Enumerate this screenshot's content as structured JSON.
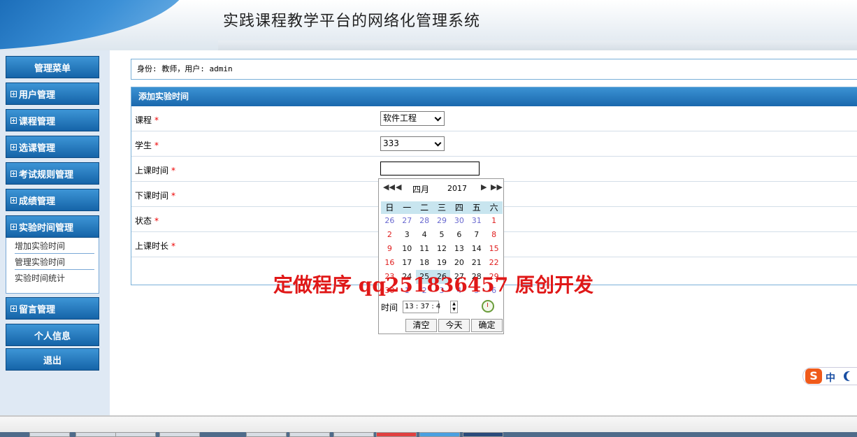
{
  "header": {
    "title": "实践课程教学平台的网络化管理系统"
  },
  "sidebar": {
    "menu_title": "管理菜单",
    "items": [
      {
        "label": "用户管理"
      },
      {
        "label": "课程管理"
      },
      {
        "label": "选课管理"
      },
      {
        "label": "考试规则管理"
      },
      {
        "label": "成绩管理"
      },
      {
        "label": "实验时间管理"
      }
    ],
    "subitems": [
      "增加实验时间",
      "管理实验时间",
      "实验时间统计"
    ],
    "after": [
      {
        "label": "留言管理"
      }
    ],
    "profile": "个人信息",
    "logout": "退出"
  },
  "userbar": {
    "text": "身份: 教师，用户: admin"
  },
  "form": {
    "title": "添加实验时间",
    "required_mark": "*",
    "fields": [
      {
        "label": "课程",
        "type": "select",
        "value": "软件工程"
      },
      {
        "label": "学生",
        "type": "select",
        "value": "333"
      },
      {
        "label": "上课时间",
        "type": "text",
        "value": ""
      },
      {
        "label": "下课时间"
      },
      {
        "label": "状态"
      },
      {
        "label": "上课时长"
      }
    ]
  },
  "datepicker": {
    "month": "四月",
    "year": "2017",
    "weekdays": [
      "日",
      "一",
      "二",
      "三",
      "四",
      "五",
      "六"
    ],
    "weeks": [
      [
        "26",
        "27",
        "28",
        "29",
        "30",
        "31",
        "1"
      ],
      [
        "2",
        "3",
        "4",
        "5",
        "6",
        "7",
        "8"
      ],
      [
        "9",
        "10",
        "11",
        "12",
        "13",
        "14",
        "15"
      ],
      [
        "16",
        "17",
        "18",
        "19",
        "20",
        "21",
        "22"
      ],
      [
        "23",
        "24",
        "25",
        "26",
        "27",
        "28",
        "29"
      ],
      [
        "30",
        "1",
        "2",
        "3",
        "4",
        "5",
        "6"
      ]
    ],
    "time_label": "时间",
    "time_value": "13 : 37 : 4",
    "buttons": {
      "clear": "清空",
      "today": "今天",
      "ok": "确定"
    }
  },
  "watermark": "定做程序 qq251836457 原创开发",
  "ime": {
    "lang": "中"
  }
}
